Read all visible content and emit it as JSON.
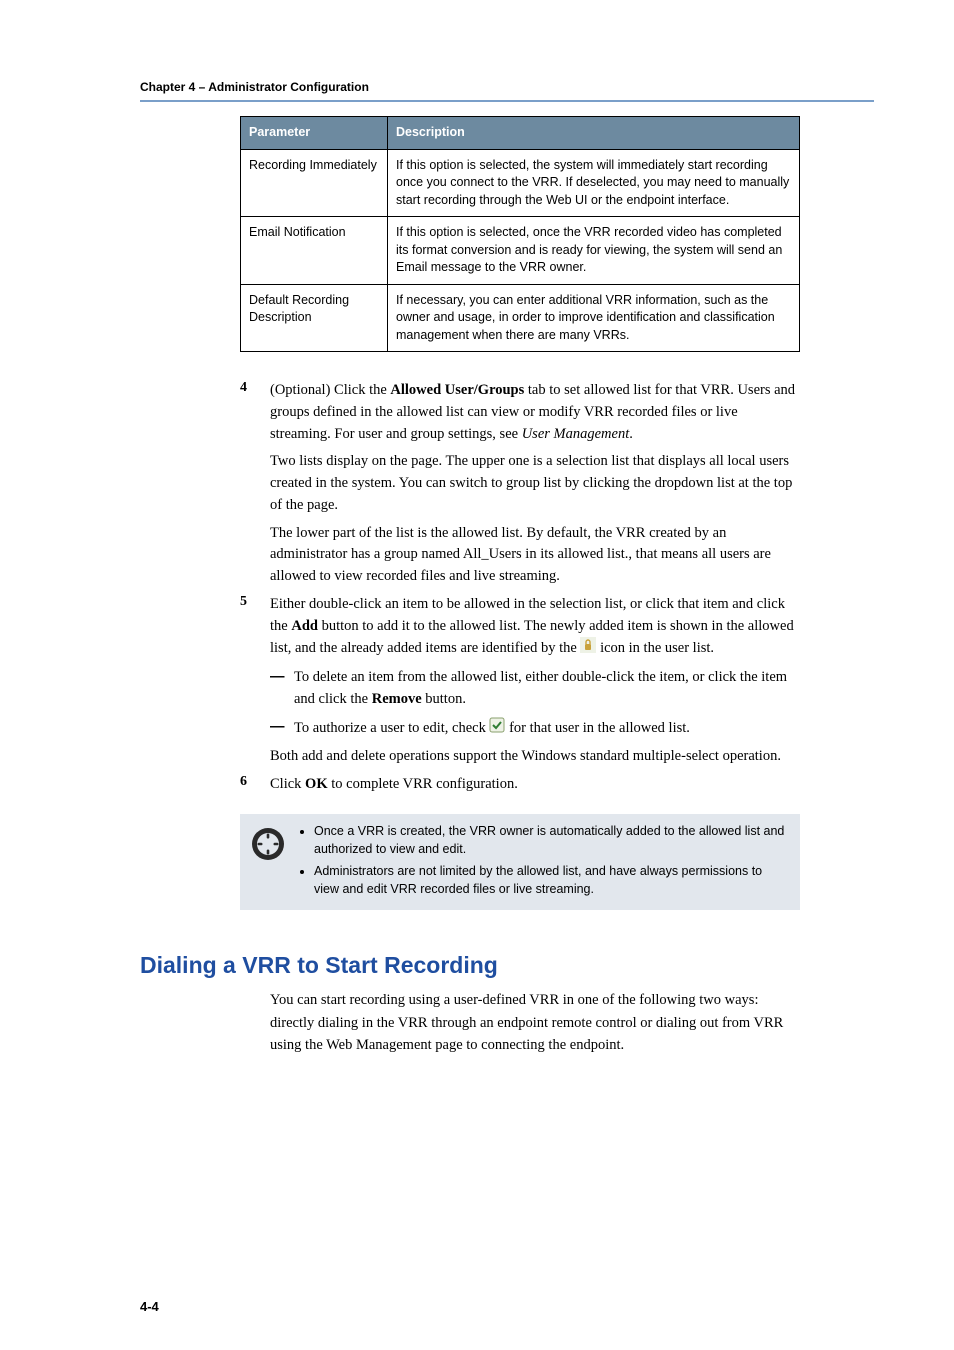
{
  "header": "Chapter 4 – Administrator Configuration",
  "table": {
    "head_param": "Parameter",
    "head_desc": "Description",
    "rows": [
      {
        "param": "Recording Immediately",
        "desc": "If this option is selected, the system will immediately start recording once you connect to the VRR. If deselected, you may need to manually start recording through the Web UI or the endpoint interface."
      },
      {
        "param": "Email Notification",
        "desc": "If this option is selected, once the VRR recorded video has completed its format conversion and is ready for viewing, the system will send an Email message to the VRR owner."
      },
      {
        "param": "Default Recording Description",
        "desc": "If necessary, you can enter additional VRR information, such as the owner and usage, in order to improve identification and classification management when there are many VRRs."
      }
    ]
  },
  "steps": {
    "s4": {
      "num": "4",
      "lead": "(Optional) Click the ",
      "bold1": "Allowed User/Groups",
      "after_bold1": " tab to set allowed list for that VRR. Users and groups defined in the allowed list can view or modify VRR recorded files or live streaming. For user and group settings, see ",
      "italic1": "User Management",
      "tail": ".",
      "p2": "Two lists display on the page. The upper one is a selection list that displays all local users created in the system. You can switch to group list by clicking the dropdown list at the top of the page.",
      "p3": "The lower part of the list is the allowed list. By default, the VRR created by an administrator has a group named All_Users in its allowed list., that means all users are allowed to view recorded files and live streaming."
    },
    "s5": {
      "num": "5",
      "lead": "Either double-click an item to be allowed in the selection list, or click that item and click the ",
      "bold1": "Add",
      "after_bold1": " button to add it to the allowed list. The newly added item is shown in the allowed list, and the already added items are identified by the ",
      "after_icon": " icon in the user list.",
      "d1_lead": "To delete an item from the allowed list, either double-click the item, or click the item and click the ",
      "d1_bold": "Remove",
      "d1_tail": " button.",
      "d2_lead": "To authorize a user to edit, check ",
      "d2_tail": " for that user in the allowed list.",
      "p2": "Both add and delete operations support the Windows standard multiple-select operation."
    },
    "s6": {
      "num": "6",
      "lead": "Click ",
      "bold1": "OK",
      "tail": " to complete VRR configuration."
    }
  },
  "notes": {
    "n1": "Once a VRR is created, the VRR owner is automatically added to the allowed list and authorized to view and edit.",
    "n2": "Administrators are not limited by the allowed list, and have always permissions to view and edit VRR recorded files or live streaming."
  },
  "section": {
    "title": "Dialing a VRR to Start Recording",
    "para": "You can start recording using a user-defined VRR in one of the following two ways: directly dialing in the VRR through an endpoint remote control or dialing out from VRR using the Web Management page to connecting the endpoint."
  },
  "page_number": "4-4"
}
